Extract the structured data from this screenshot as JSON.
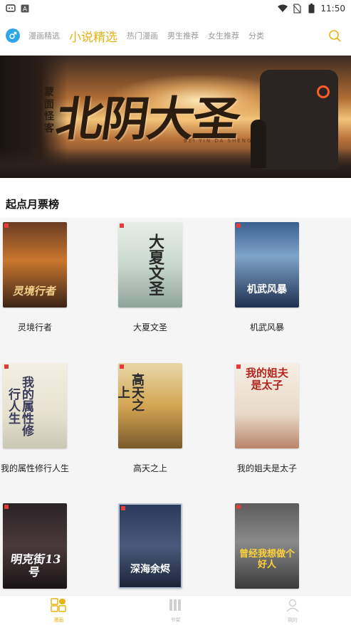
{
  "status_bar": {
    "time": "11:50",
    "left_icons": [
      "app-icon",
      "a-icon"
    ],
    "right_icons": [
      "wifi-icon",
      "no-sim-icon",
      "battery-icon"
    ]
  },
  "nav": {
    "gender_icon": "male-icon",
    "tabs": [
      {
        "label": "漫画精选",
        "active": false
      },
      {
        "label": "小说精选",
        "active": true
      },
      {
        "label": "热门漫画",
        "active": false
      },
      {
        "label": "男生推荐",
        "active": false
      },
      {
        "label": "女生推荐",
        "active": false
      },
      {
        "label": "分类",
        "active": false
      }
    ],
    "search_icon": "search-icon",
    "accent_color": "#e6b314"
  },
  "banner": {
    "title": "北阴大圣",
    "author": "蒙面怪客",
    "author_tag": "著",
    "pinyin": "BEI YIN DA SHENG"
  },
  "section": {
    "title": "起点月票榜"
  },
  "books": [
    {
      "name": "灵境行者",
      "cover_text": "灵境行者"
    },
    {
      "name": "大夏文圣",
      "cover_text": "大夏文圣"
    },
    {
      "name": "机武风暴",
      "cover_text": "机武风暴"
    },
    {
      "name": "我的属性修行人生",
      "cover_text": "我的属性修行人生"
    },
    {
      "name": "高天之上",
      "cover_text": "高天之上"
    },
    {
      "name": "我的姐夫是太子",
      "cover_text": "我的姐夫是太子"
    },
    {
      "name": "",
      "cover_text": "明克街13号"
    },
    {
      "name": "",
      "cover_text": "深海余烬"
    },
    {
      "name": "",
      "cover_text": "曾经我想做个好人"
    }
  ],
  "bottom_nav": [
    {
      "label": "漫画",
      "icon": "grid-icon",
      "active": true
    },
    {
      "label": "书架",
      "icon": "bookshelf-icon",
      "active": false
    },
    {
      "label": "我的",
      "icon": "user-icon",
      "active": false
    }
  ]
}
